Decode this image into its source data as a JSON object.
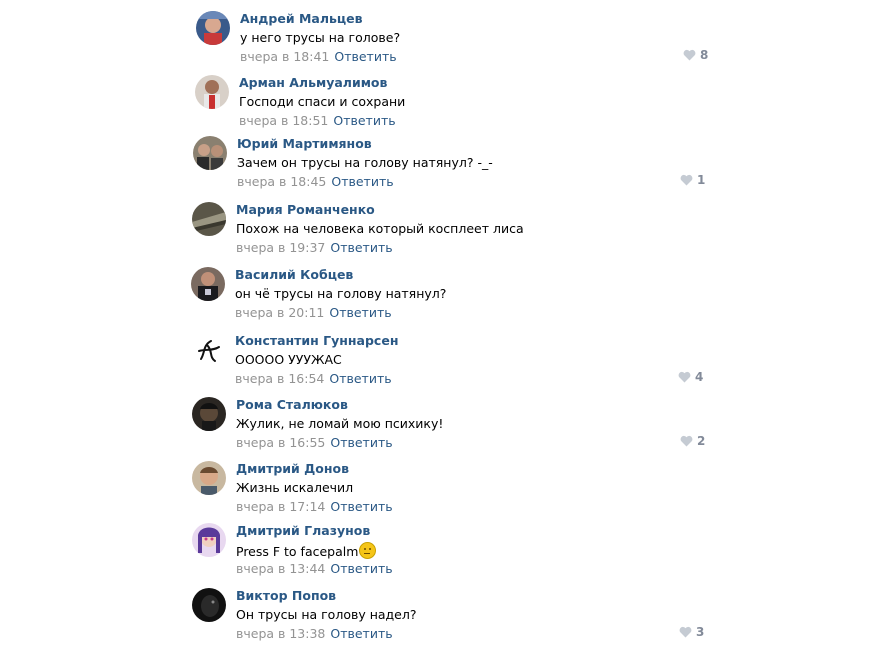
{
  "comments": [
    {
      "author": "Андрей Мальцев",
      "text": "у него трусы на голове?",
      "time": "вчера в 18:41",
      "reply": "Ответить",
      "likes": "8",
      "avatar_color": "#8a6a5a"
    },
    {
      "author": "Арман Альмуалимов",
      "text": "Господи спаси и сохрани",
      "time": "вчера в 18:51",
      "reply": "Ответить",
      "likes": "",
      "avatar_color": "#c8b8b0"
    },
    {
      "author": "Юрий Мартимянов",
      "text": "Зачем он трусы на голову натянул? -_-",
      "time": "вчера в 18:45",
      "reply": "Ответить",
      "likes": "1",
      "avatar_color": "#5a5048"
    },
    {
      "author": "Мария Романченко",
      "text": "Похож на человека который косплеет лиса",
      "time": "вчера в 19:37",
      "reply": "Ответить",
      "likes": "",
      "avatar_color": "#6e6a5a"
    },
    {
      "author": "Василий Кобцев",
      "text": "он чё трусы на голову натянул?",
      "time": "вчера в 20:11",
      "reply": "Ответить",
      "likes": "",
      "avatar_color": "#4a3e38"
    },
    {
      "author": "Константин Гуннарсен",
      "text": "ООООО УУУЖАС",
      "time": "вчера в 16:54",
      "reply": "Ответить",
      "likes": "4",
      "avatar_color": "#ffffff"
    },
    {
      "author": "Рома Сталюков",
      "text": "Жулик, не ломай мою психику!",
      "time": "вчера в 16:55",
      "reply": "Ответить",
      "likes": "2",
      "avatar_color": "#2e2a26"
    },
    {
      "author": "Дмитрий Донов",
      "text": "Жизнь искалечил",
      "time": "вчера в 17:14",
      "reply": "Ответить",
      "likes": "",
      "avatar_color": "#b09078"
    },
    {
      "author": "Дмитрий Глазунов",
      "text": "Press F to facepalm",
      "time": "вчера в 13:44",
      "reply": "Ответить",
      "likes": "",
      "avatar_color": "#7a5aa8"
    },
    {
      "author": "Виктор Попов",
      "text": "Он трусы на голову надел?",
      "time": "вчера в 13:38",
      "reply": "Ответить",
      "likes": "3",
      "avatar_color": "#1e1e1e"
    }
  ],
  "colors": {
    "link": "#2a5885",
    "meta": "#939393",
    "like": "#828a99"
  }
}
